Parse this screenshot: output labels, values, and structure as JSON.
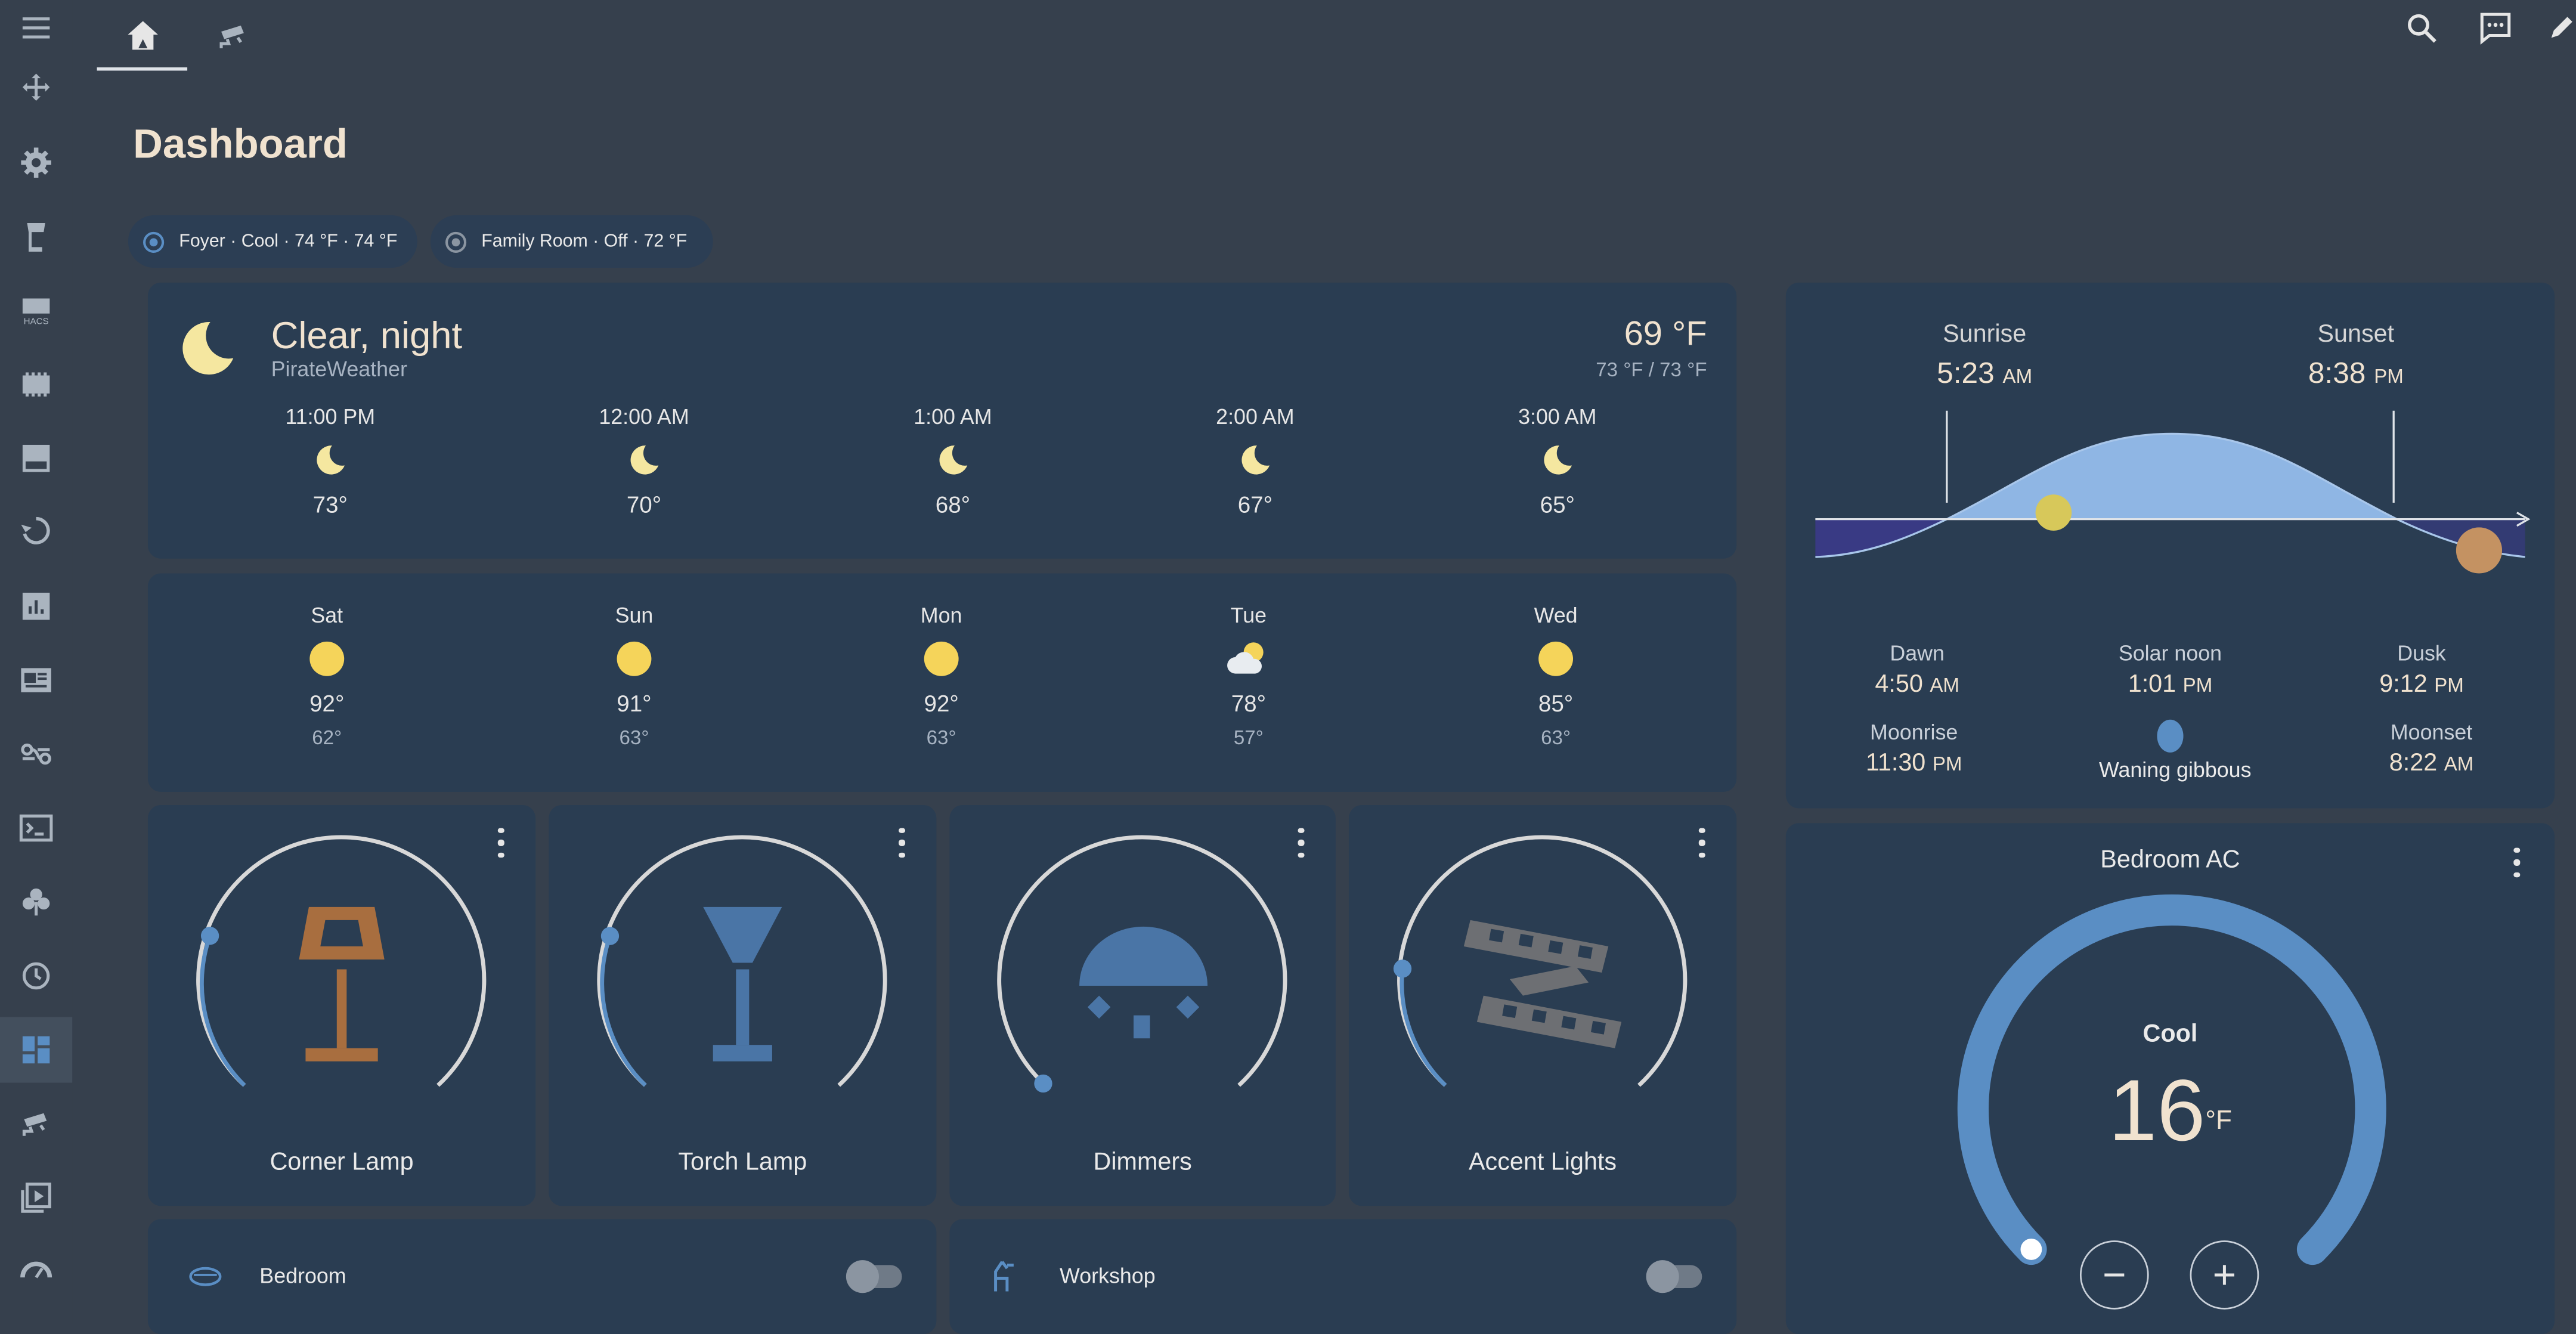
{
  "header": {
    "title": "Dashboard",
    "tabs": [
      {
        "icon": "home-roof-icon",
        "active": true
      },
      {
        "icon": "cctv-icon",
        "active": false
      }
    ],
    "actions": [
      "search-icon",
      "assist-chat-icon",
      "edit-pencil-icon"
    ]
  },
  "sidebar": {
    "items": [
      {
        "icon": "menu-icon"
      },
      {
        "icon": "arrows-move-icon"
      },
      {
        "icon": "cog-icon"
      },
      {
        "icon": "chess-rook-icon"
      },
      {
        "icon": "hacs-store-icon",
        "label": "HACS"
      },
      {
        "icon": "memory-chip-icon"
      },
      {
        "icon": "server-icon"
      },
      {
        "icon": "restore-icon"
      },
      {
        "icon": "chart-bar-icon"
      },
      {
        "icon": "newspaper-icon"
      },
      {
        "icon": "hub-nodes-icon"
      },
      {
        "icon": "console-icon"
      },
      {
        "icon": "clover-icon"
      },
      {
        "icon": "history-icon"
      },
      {
        "icon": "dashboard-icon",
        "active": true
      },
      {
        "icon": "cctv-icon"
      },
      {
        "icon": "media-play-icon"
      },
      {
        "icon": "gauge-icon"
      }
    ]
  },
  "chips": [
    {
      "label": "Foyer · Cool · 74 °F · 74 °F"
    },
    {
      "label": "Family Room · Off · 72 °F"
    }
  ],
  "weather": {
    "condition": "Clear, night",
    "source": "PirateWeather",
    "temperature": "69 °F",
    "range": "73 °F / 73 °F",
    "hourly": [
      {
        "time": "11:00 PM",
        "temp": "73°",
        "icon": "moon-icon"
      },
      {
        "time": "12:00 AM",
        "temp": "70°",
        "icon": "moon-icon"
      },
      {
        "time": "1:00 AM",
        "temp": "68°",
        "icon": "moon-icon"
      },
      {
        "time": "2:00 AM",
        "temp": "67°",
        "icon": "moon-icon"
      },
      {
        "time": "3:00 AM",
        "temp": "65°",
        "icon": "moon-icon"
      }
    ],
    "daily": [
      {
        "day": "Sat",
        "high": "92°",
        "low": "62°",
        "icon": "sun-icon"
      },
      {
        "day": "Sun",
        "high": "91°",
        "low": "63°",
        "icon": "sun-icon"
      },
      {
        "day": "Mon",
        "high": "92°",
        "low": "63°",
        "icon": "sun-icon"
      },
      {
        "day": "Tue",
        "high": "78°",
        "low": "57°",
        "icon": "partly-cloudy-icon"
      },
      {
        "day": "Wed",
        "high": "85°",
        "low": "63°",
        "icon": "sun-icon"
      }
    ]
  },
  "lights": [
    {
      "name": "Corner Lamp",
      "icon": "floor-lamp-icon",
      "brightness_pct": 22,
      "icon_color": "#a86e3f"
    },
    {
      "name": "Torch Lamp",
      "icon": "torch-lamp-icon",
      "brightness_pct": 20,
      "icon_color": "#4a75a6"
    },
    {
      "name": "Dimmers",
      "icon": "ceiling-light-icon",
      "brightness_pct": 0,
      "icon_color": "#4a75a6"
    },
    {
      "name": "Accent Lights",
      "icon": "led-strip-icon",
      "brightness_pct": 25,
      "icon_color": "#6d6f73"
    }
  ],
  "sun": {
    "sunrise_label": "Sunrise",
    "sunrise_time": "5:23",
    "sunrise_ampm": "AM",
    "sunset_label": "Sunset",
    "sunset_time": "8:38",
    "sunset_ampm": "PM",
    "dawn_label": "Dawn",
    "dawn_time": "4:50",
    "dawn_ampm": "AM",
    "noon_label": "Solar noon",
    "noon_time": "1:01",
    "noon_ampm": "PM",
    "dusk_label": "Dusk",
    "dusk_time": "9:12",
    "dusk_ampm": "PM",
    "moonrise_label": "Moonrise",
    "moonrise_time": "11:30",
    "moonrise_ampm": "PM",
    "moon_phase": "Waning gibbous",
    "moonset_label": "Moonset",
    "moonset_time": "8:22",
    "moonset_ampm": "AM"
  },
  "thermostat": {
    "name": "Bedroom AC",
    "mode": "Cool",
    "target": "16",
    "unit": "°F",
    "accent": "#5a8ec4"
  },
  "rooms": [
    {
      "name": "Bedroom",
      "icon": "bed-icon",
      "on": false
    },
    {
      "name": "Workshop",
      "icon": "tools-icon",
      "on": false
    }
  ],
  "colors": {
    "background": "#36404d",
    "card": "#2a3d52",
    "title": "#f0e2cf",
    "accent_blue": "#5a8ec4",
    "sun_yellow": "#f5d45a",
    "moon_yellow": "#f5e7a0"
  }
}
